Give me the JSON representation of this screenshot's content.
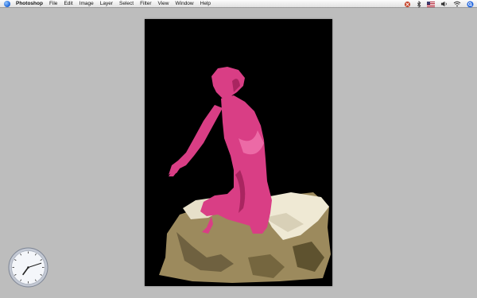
{
  "menubar": {
    "app_name": "Photoshop",
    "items": [
      "File",
      "Edit",
      "Image",
      "Layer",
      "Select",
      "Filter",
      "View",
      "Window",
      "Help"
    ],
    "status_icons": [
      "script-icon",
      "bluetooth-icon",
      "flag-icon",
      "volume-icon",
      "wifi-icon",
      "spotlight-icon"
    ]
  },
  "document": {
    "background_color": "#000000",
    "figure_color": "#d93e85",
    "rock_color": "#a39267"
  },
  "dock_clock": {
    "hour": 7,
    "minute": 12
  }
}
